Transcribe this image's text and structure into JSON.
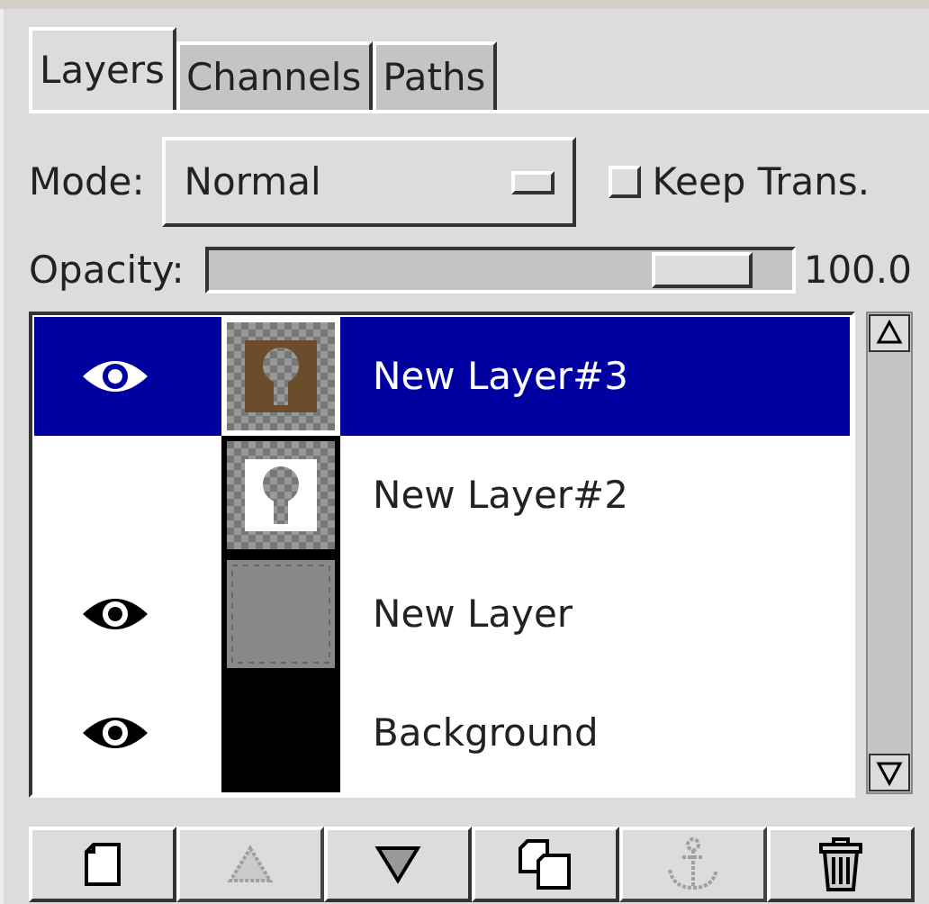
{
  "tabs": [
    {
      "label": "Layers",
      "selected": true
    },
    {
      "label": "Channels",
      "selected": false
    },
    {
      "label": "Paths",
      "selected": false
    }
  ],
  "mode": {
    "label": "Mode:",
    "value": "Normal"
  },
  "keep_trans": {
    "label": "Keep Trans.",
    "checked": false
  },
  "opacity": {
    "label": "Opacity:",
    "level": 0.93,
    "reading": "100.0"
  },
  "layers": [
    {
      "name": "New Layer#3",
      "visible": true,
      "selected": true,
      "kind": "keyhole-brown"
    },
    {
      "name": "New Layer#2",
      "visible": false,
      "selected": false,
      "kind": "keyhole-white"
    },
    {
      "name": "New Layer",
      "visible": true,
      "selected": false,
      "kind": "gray"
    },
    {
      "name": "Background",
      "visible": true,
      "selected": false,
      "kind": "black"
    }
  ],
  "buttons": [
    {
      "kind": "new",
      "disabled": false
    },
    {
      "kind": "raise",
      "disabled": true
    },
    {
      "kind": "lower",
      "disabled": false
    },
    {
      "kind": "duplicate",
      "disabled": false
    },
    {
      "kind": "anchor",
      "disabled": true
    },
    {
      "kind": "delete",
      "disabled": false
    }
  ]
}
